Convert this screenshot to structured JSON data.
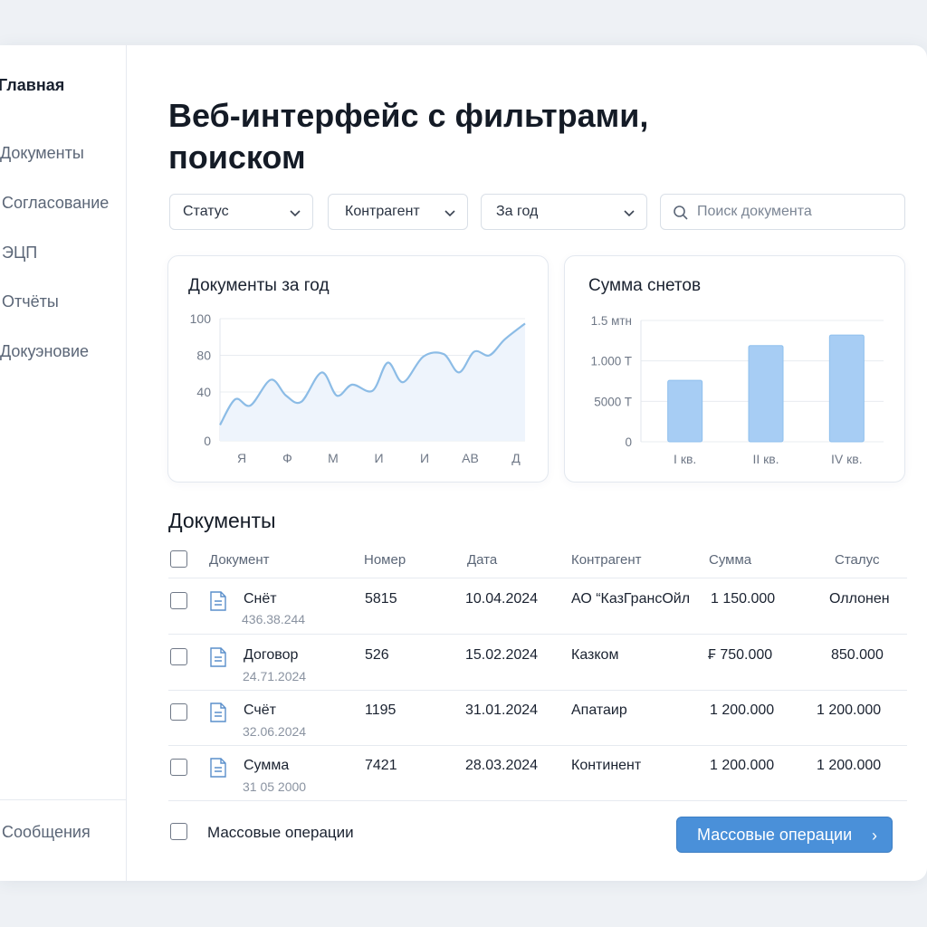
{
  "sidebar": {
    "items": [
      {
        "label": "Главная",
        "active": true
      },
      {
        "label": "Документы",
        "active": false
      },
      {
        "label": "Согласование",
        "active": false
      },
      {
        "label": "ЭЦП",
        "active": false
      },
      {
        "label": "Отчёты",
        "active": false
      },
      {
        "label": "Докуэновие",
        "active": false
      }
    ],
    "bottom_item": "Сообщения"
  },
  "header": {
    "title": "Веб-интерфейс с фильтрами, поиском"
  },
  "filters": {
    "status": "Статус",
    "counterparty": "Контрагент",
    "period": "За год",
    "search_placeholder": "Поиск документа"
  },
  "line_card": {
    "title": "Документы за год"
  },
  "bar_card": {
    "title": "Сумма снетов"
  },
  "chart_data": [
    {
      "type": "line",
      "title": "Документы за год",
      "x_tick_labels": [
        "Я",
        "Ф",
        "М",
        "И",
        "И",
        "АВ",
        "Д"
      ],
      "y_tick_labels": [
        "100",
        "80",
        "40",
        "0"
      ],
      "y_tick_values": [
        100,
        70,
        40,
        0
      ],
      "ylim": [
        0,
        100
      ],
      "grid": true,
      "x": [
        0,
        0.3,
        0.6,
        1.0,
        1.3,
        1.6,
        2.0,
        2.3,
        2.6,
        3.0,
        3.3,
        3.6,
        4.0,
        4.4,
        4.7,
        5.0,
        5.3,
        5.6,
        6.0
      ],
      "values": [
        13,
        34,
        29,
        50,
        37,
        32,
        56,
        37,
        46,
        41,
        64,
        48,
        69,
        71,
        56,
        73,
        70,
        83,
        96
      ]
    },
    {
      "type": "bar",
      "title": "Сумма снетов",
      "categories": [
        "I кв.",
        "II кв.",
        "IV кв."
      ],
      "y_tick_labels": [
        "1.5 мтн",
        "1.000 T",
        "5000 T",
        "0"
      ],
      "y_tick_values": [
        1.5,
        1.0,
        0.5,
        0
      ],
      "ylim": [
        0,
        1.5
      ],
      "values": [
        0.76,
        1.19,
        1.32
      ],
      "colors": [
        "#a7cdf4"
      ],
      "grid": true
    }
  ],
  "table": {
    "section_title": "Документы",
    "columns": [
      "Документ",
      "Номер",
      "Дата",
      "Контрагент",
      "Сумма",
      "Сталус"
    ],
    "rows": [
      {
        "doc": "Снёт",
        "doc_sub": "436.38.244",
        "number": "5815",
        "date": "10.04.2024",
        "counterparty": "АО “КазГрансОйл",
        "sum": "1 150.000",
        "status": "Оллонен"
      },
      {
        "doc": "Договор",
        "doc_sub": "24.71.2024",
        "number": "526",
        "date": "15.02.2024",
        "counterparty": "Казком",
        "sum": "₣ 750.000",
        "status": "850.000"
      },
      {
        "doc": "Счёт",
        "doc_sub": "32.06.2024",
        "number": "1195",
        "date": "31.01.2024",
        "counterparty": "Апатаир",
        "sum": "1 200.000",
        "status": "1 200.000"
      },
      {
        "doc": "Сумма",
        "doc_sub": "31 05 2000",
        "number": "7421",
        "date": "28.03.2024",
        "counterparty": "Континент",
        "sum": "1 200.000",
        "status": "1 200.000"
      }
    ]
  },
  "footer": {
    "bulk_label": "Массовые операции",
    "bulk_button": "Массовые операции",
    "bulk_button_arrow": "›"
  },
  "colors": {
    "accent": "#4a90d9",
    "bar_fill": "#a7cdf4",
    "line_stroke": "#8cbce6"
  }
}
